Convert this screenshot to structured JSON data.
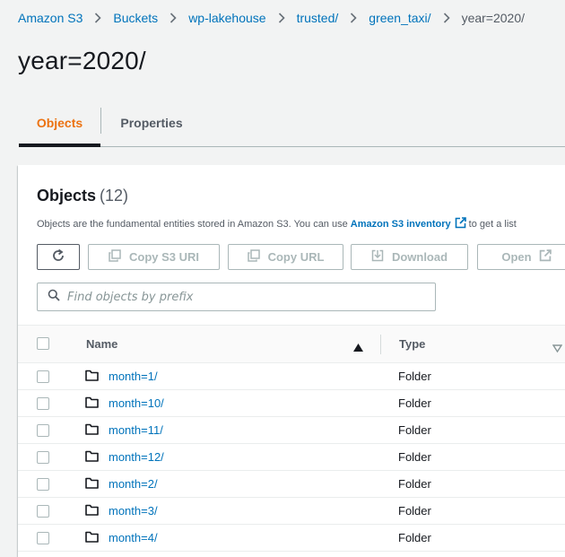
{
  "breadcrumb": {
    "items": [
      "Amazon S3",
      "Buckets",
      "wp-lakehouse",
      "trusted/",
      "green_taxi/"
    ],
    "current": "year=2020/"
  },
  "page_title": "year=2020/",
  "tabs": [
    {
      "label": "Objects",
      "active": true
    },
    {
      "label": "Properties",
      "active": false
    }
  ],
  "objects_panel": {
    "title": "Objects",
    "count": "(12)",
    "description_prefix": "Objects are the fundamental entities stored in Amazon S3. You can use ",
    "inventory_link": "Amazon S3 inventory",
    "description_suffix": "to get a list"
  },
  "toolbar": {
    "copy_s3_uri": "Copy S3 URI",
    "copy_url": "Copy URL",
    "download": "Download",
    "open": "Open"
  },
  "search": {
    "placeholder": "Find objects by prefix",
    "value": ""
  },
  "table": {
    "columns": [
      "Name",
      "Type"
    ],
    "rows": [
      {
        "name": "month=1/",
        "type": "Folder"
      },
      {
        "name": "month=10/",
        "type": "Folder"
      },
      {
        "name": "month=11/",
        "type": "Folder"
      },
      {
        "name": "month=12/",
        "type": "Folder"
      },
      {
        "name": "month=2/",
        "type": "Folder"
      },
      {
        "name": "month=3/",
        "type": "Folder"
      },
      {
        "name": "month=4/",
        "type": "Folder"
      }
    ]
  },
  "colors": {
    "link": "#0073bb",
    "accent": "#ec7211",
    "text": "#16191f",
    "muted": "#545b64",
    "disabled": "#aab7b8",
    "background": "#f2f3f3"
  },
  "icons": [
    "chevron-right-icon",
    "external-link-icon",
    "refresh-icon",
    "copy-icon",
    "download-icon",
    "search-icon",
    "sort-ascending-icon",
    "sort-icon",
    "folder-icon"
  ]
}
